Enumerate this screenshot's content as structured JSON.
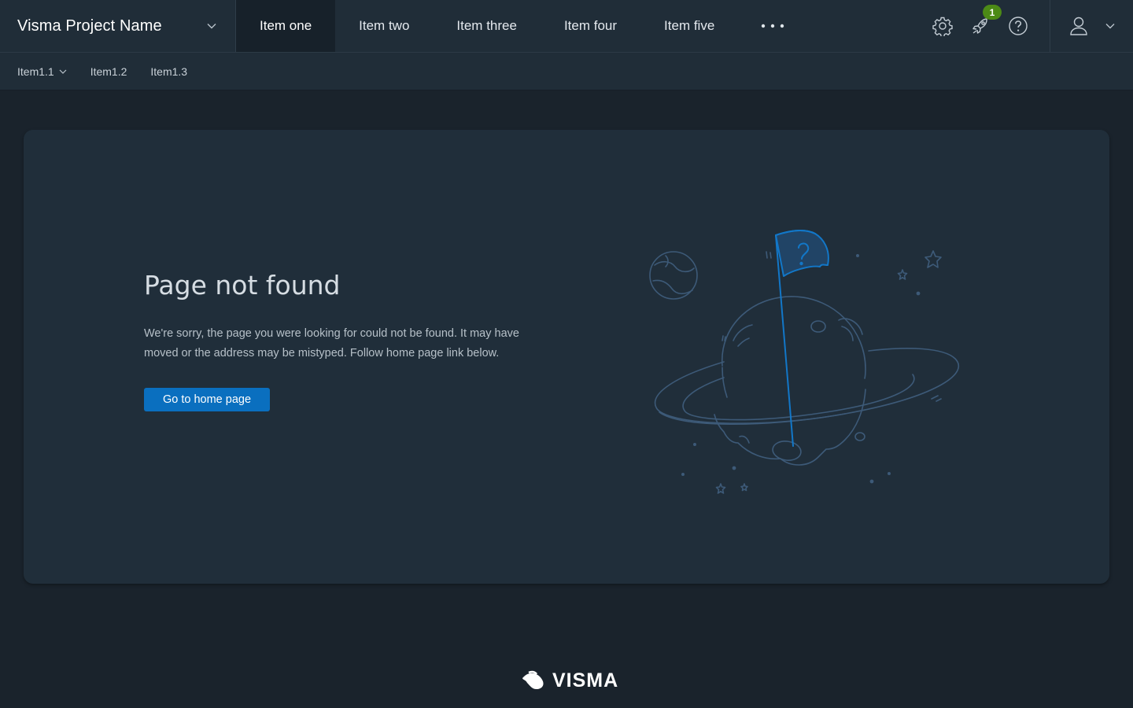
{
  "header": {
    "project_name": "Visma Project Name",
    "nav_items": [
      {
        "label": "Item one"
      },
      {
        "label": "Item two"
      },
      {
        "label": "Item three"
      },
      {
        "label": "Item four"
      },
      {
        "label": "Item five"
      }
    ],
    "more_icon": "more-dots-icon",
    "tools": {
      "settings_icon": "gear-icon",
      "notifications_icon": "rocket-icon",
      "notification_count": "1",
      "help_icon": "help-circle-icon",
      "user_icon": "user-icon"
    }
  },
  "subnav": {
    "items": [
      {
        "label": "Item1.1"
      },
      {
        "label": "Item1.2"
      },
      {
        "label": "Item1.3"
      }
    ]
  },
  "main": {
    "title": "Page not found",
    "description": "We're sorry, the page you were looking for could not be found. It may have moved or the address may be mistyped. Follow home page link below.",
    "home_button": "Go to home page",
    "illustration": "planet-with-question-flag"
  },
  "footer": {
    "logo": "VISMA"
  },
  "colors": {
    "background": "#1a232c",
    "navbar": "#202d38",
    "card": "#202e3a",
    "primary_button": "#0a6fbf",
    "badge": "#4c8a16",
    "illustration_line": "#3d5a78",
    "flag_accent": "#1277c8"
  }
}
